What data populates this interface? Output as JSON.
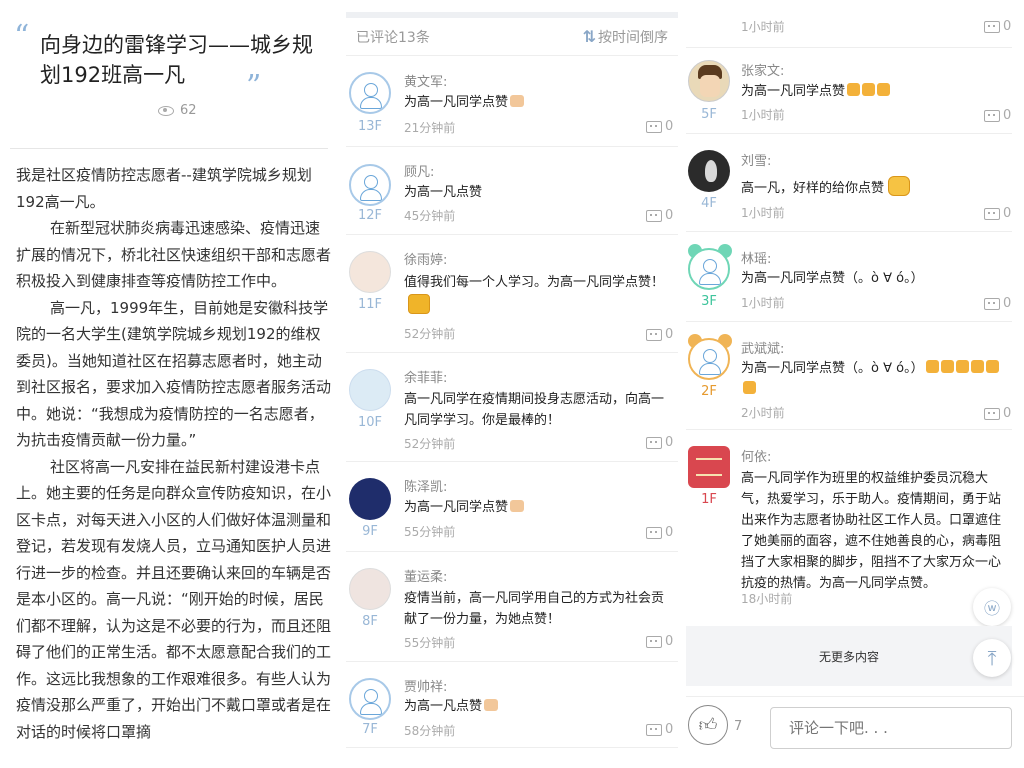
{
  "article": {
    "title": "向身边的雷锋学习——城乡规划192班高一凡",
    "views": "62",
    "paragraphs": [
      "我是社区疫情防控志愿者--建筑学院城乡规划192高一凡。",
      "在新型冠状肺炎病毒迅速感染、疫情迅速扩展的情况下，桥北社区快速组织干部和志愿者积极投入到健康排查等疫情防控工作中。",
      "高一凡，1999年生，目前她是安徽科技学院的一名大学生(建筑学院城乡规划192的维权委员)。当她知道社区在招募志愿者时，她主动到社区报名，要求加入疫情防控志愿者服务活动中。她说：“我想成为疫情防控的一名志愿者，为抗击疫情贡献一份力量。”",
      "社区将高一凡安排在益民新村建设港卡点上。她主要的任务是向群众宣传防疫知识，在小区卡点，对每天进入小区的人们做好体温测量和登记，若发现有发烧人员，立马通知医护人员进行进一步的检查。并且还要确认来回的车辆是否是本小区的。高一凡说：“刚开始的时候，居民们都不理解，认为这是不必要的行为，而且还阻碍了他们的正常生活。都不太愿意配合我们的工作。这远比我想象的工作艰难很多。有些人认为疫情没那么严重了，开始出门不戴口罩或者是在对话的时候将口罩摘"
    ]
  },
  "comments_panel": {
    "count_label": "已评论13条",
    "sort_label": "按时间倒序"
  },
  "comments_left": [
    {
      "name": "黄文军:",
      "text": "为高一凡同学点赞",
      "time": "21分钟前",
      "floor": "13F",
      "replies": "0"
    },
    {
      "name": "顾凡:",
      "text": "为高一凡点赞",
      "time": "45分钟前",
      "floor": "12F",
      "replies": "0"
    },
    {
      "name": "徐雨婷:",
      "text": "值得我们每一个人学习。为高一凡同学点赞！",
      "time": "52分钟前",
      "floor": "11F",
      "replies": "0"
    },
    {
      "name": "余菲菲:",
      "text": "高一凡同学在疫情期间投身志愿活动，向高一凡同学学习。你是最棒的！",
      "time": "52分钟前",
      "floor": "10F",
      "replies": "0"
    },
    {
      "name": "陈泽凯:",
      "text": "为高一凡同学点赞",
      "time": "55分钟前",
      "floor": "9F",
      "replies": "0"
    },
    {
      "name": "董运柔:",
      "text": "疫情当前，高一凡同学用自己的方式为社会贡献了一份力量，为她点赞！",
      "time": "55分钟前",
      "floor": "8F",
      "replies": "0"
    },
    {
      "name": "贾帅祥:",
      "text": "为高一凡点赞",
      "time": "58分钟前",
      "floor": "7F",
      "replies": "0"
    }
  ],
  "comments_right": [
    {
      "time": "1小时前",
      "replies": "0"
    },
    {
      "name": "张家文:",
      "text": "为高一凡同学点赞",
      "time": "1小时前",
      "floor": "5F",
      "replies": "0"
    },
    {
      "name": "刘雪:",
      "text": "高一凡，好样的给你点赞",
      "time": "1小时前",
      "floor": "4F",
      "replies": "0"
    },
    {
      "name": "林瑶:",
      "text": "为高一凡同学点赞（。ò ∀ ó。）",
      "time": "1小时前",
      "floor": "3F",
      "replies": "0"
    },
    {
      "name": "武斌斌:",
      "text": "为高一凡同学点赞（。ò ∀ ó。）",
      "time": "2小时前",
      "floor": "2F",
      "replies": "0"
    },
    {
      "name": "何依:",
      "text": "高一凡同学作为班里的权益维护委员沉稳大气，热爱学习，乐于助人。疫情期间，勇于站出来作为志愿者协助社区工作人员。口罩遮住了她美丽的面容，遮不住她善良的心，病毒阻挡了大家相聚的脚步，阻挡不了大家万众一心抗疫的热情。为高一凡同学点赞。",
      "time": "18小时前",
      "floor": "1F"
    }
  ],
  "footer": {
    "no_more": "无更多内容",
    "like_count": "7",
    "comment_placeholder": "评论一下吧. . ."
  }
}
